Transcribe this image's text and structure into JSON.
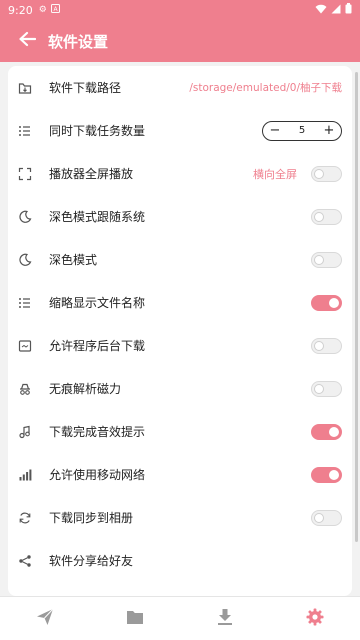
{
  "status_bar": {
    "time": "9:20",
    "icons": [
      "notification-gear-icon",
      "notification-a-icon",
      "wifi-icon",
      "signal-icon",
      "battery-icon"
    ]
  },
  "app_bar": {
    "title": "软件设置",
    "back_icon": "arrow-left-icon"
  },
  "settings": {
    "download_path": {
      "label": "软件下载路径",
      "value": "/storage/emulated/0/柚子下载",
      "icon": "folder-download-icon"
    },
    "concurrent_tasks": {
      "label": "同时下载任务数量",
      "value": "5",
      "icon": "list-icon",
      "minus": "−",
      "plus": "+"
    },
    "player_fullscreen": {
      "label": "播放器全屏播放",
      "value": "横向全屏",
      "icon": "fullscreen-icon",
      "enabled": false
    },
    "dark_follow_system": {
      "label": "深色模式跟随系统",
      "icon": "moon-icon",
      "enabled": false
    },
    "dark_mode": {
      "label": "深色模式",
      "icon": "moon-icon",
      "enabled": false
    },
    "short_filename": {
      "label": "缩略显示文件名称",
      "icon": "list-icon",
      "enabled": true
    },
    "background_download": {
      "label": "允许程序后台下载",
      "icon": "window-icon",
      "enabled": false
    },
    "no_trace_magnet": {
      "label": "无痕解析磁力",
      "icon": "incognito-icon",
      "enabled": false
    },
    "complete_sound": {
      "label": "下载完成音效提示",
      "icon": "music-icon",
      "enabled": true
    },
    "mobile_network": {
      "label": "允许使用移动网络",
      "icon": "signal-bars-icon",
      "enabled": true
    },
    "sync_album": {
      "label": "下载同步到相册",
      "icon": "sync-icon",
      "enabled": false
    },
    "share_app": {
      "label": "软件分享给好友",
      "icon": "share-icon"
    }
  },
  "bottom_nav": {
    "items": [
      {
        "icon": "send-icon",
        "active": false
      },
      {
        "icon": "folder-icon",
        "active": false
      },
      {
        "icon": "download-icon",
        "active": false
      },
      {
        "icon": "settings-gear-icon",
        "active": true
      }
    ]
  },
  "colors": {
    "accent": "#ef7f8e",
    "inactive_icon": "#9a9a9a",
    "background": "#f2f2f2"
  }
}
